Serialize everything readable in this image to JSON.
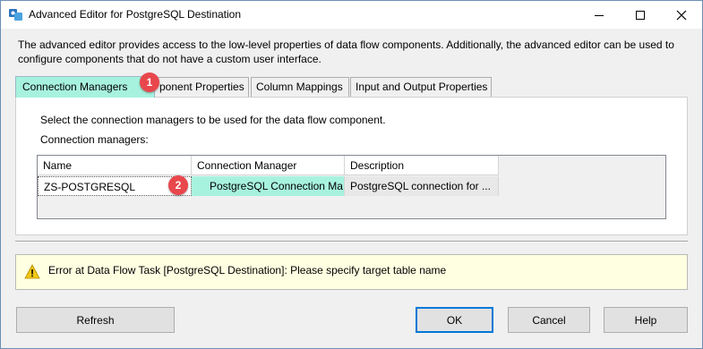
{
  "window": {
    "title": "Advanced Editor for PostgreSQL Destination",
    "icon": "ssis-component-icon",
    "controls": [
      "minimize-icon",
      "maximize-icon",
      "close-icon"
    ]
  },
  "intro_text": "The advanced editor provides access to the low-level properties of data flow components. Additionally, the advanced editor can be used to configure components that do not have a custom user interface.",
  "tabs": [
    {
      "label": "Connection Managers",
      "active": true
    },
    {
      "label": "ponent Properties",
      "active": false
    },
    {
      "label": "Column Mappings",
      "active": false
    },
    {
      "label": "Input and Output Properties",
      "active": false
    }
  ],
  "callouts": [
    "1",
    "2"
  ],
  "panel": {
    "description": "Select the connection managers to be used for the data flow component.",
    "list_label": "Connection managers:"
  },
  "grid": {
    "columns": [
      "Name",
      "Connection Manager",
      "Description"
    ],
    "rows": [
      [
        "ZS-POSTGRESQL",
        "PostgreSQL Connection Ma...",
        "PostgreSQL connection for ..."
      ]
    ]
  },
  "error": {
    "icon": "warning-icon",
    "text": "Error at Data Flow Task [PostgreSQL Destination]: Please specify target table name"
  },
  "buttons": {
    "refresh": "Refresh",
    "ok": "OK",
    "cancel": "Cancel",
    "help": "Help"
  },
  "colors": {
    "highlight": "#a7f2de",
    "callout": "#e8474c",
    "error_background": "#ffffe1"
  }
}
